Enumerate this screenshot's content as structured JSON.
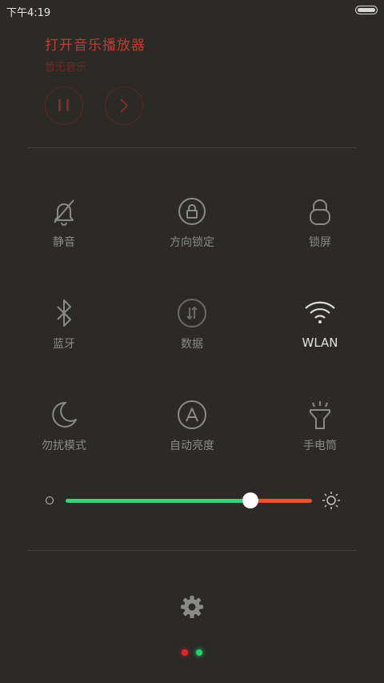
{
  "status_bar": {
    "time": "下午4:19"
  },
  "music": {
    "title": "打开音乐播放器",
    "subtitle": "暂无音乐"
  },
  "toggles": [
    {
      "label": "静音",
      "icon": "bell-off-icon"
    },
    {
      "label": "方向锁定",
      "icon": "rotation-lock-icon"
    },
    {
      "label": "锁屏",
      "icon": "lock-icon"
    },
    {
      "label": "蓝牙",
      "icon": "bluetooth-icon"
    },
    {
      "label": "数据",
      "icon": "mobile-data-icon"
    },
    {
      "label": "WLAN",
      "icon": "wifi-icon",
      "active": true
    },
    {
      "label": "勿扰模式",
      "icon": "moon-icon"
    },
    {
      "label": "自动亮度",
      "icon": "auto-brightness-icon"
    },
    {
      "label": "手电筒",
      "icon": "flashlight-icon"
    }
  ],
  "brightness": {
    "level": 0.75
  },
  "colors": {
    "accent_green": "#37d275",
    "accent_red": "#f05122",
    "music_red": "#c23a31",
    "background": "#2b2a26"
  },
  "pager": {
    "current": 1,
    "total": 2
  }
}
